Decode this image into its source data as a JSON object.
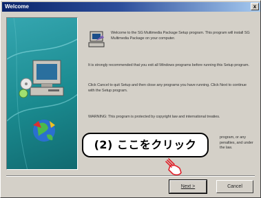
{
  "window": {
    "title": "Welcome",
    "close_label": "x"
  },
  "body": {
    "intro": "Welcome to the SG Multimedia Package Setup program. This program will install SG Multimedia Package on your computer.",
    "recommend": "It is strongly recommended that you exit all Windows programs before running this Setup program.",
    "cancel_info": "Click Cancel to quit Setup and then close any programs you have running. Click Next to continue with the Setup program.",
    "warning": "WARNING: This program is protected by copyright law and international treaties.",
    "warning_tail": "program, or any penalties, and under the law."
  },
  "callout": {
    "text": "(2) ここをクリック"
  },
  "buttons": {
    "next_label": "Next >",
    "cancel_label": "Cancel"
  },
  "icons": {
    "setup": "setup-computer-icon",
    "pointer": "pointing-hand-icon",
    "side_art": "computer-globe-illustration"
  },
  "colors": {
    "title_start": "#0a246a",
    "title_end": "#a6caf0",
    "panel": "#1a8a8f",
    "dialog_bg": "#d4d0c8"
  }
}
